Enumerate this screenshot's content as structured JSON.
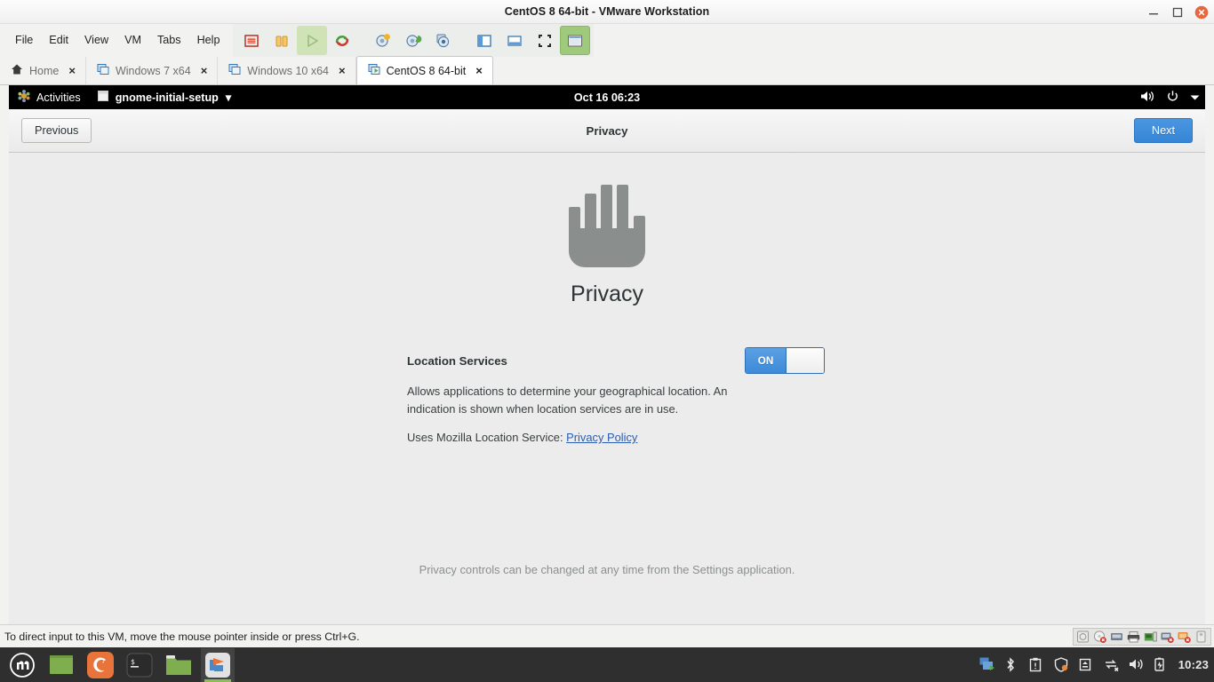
{
  "window": {
    "title": "CentOS 8 64-bit - VMware Workstation",
    "controls": [
      {
        "name": "minimize",
        "label": "–"
      },
      {
        "name": "maximize",
        "label": "□"
      },
      {
        "name": "close",
        "label": "×"
      }
    ]
  },
  "menubar": {
    "items": [
      {
        "label": "File"
      },
      {
        "label": "Edit"
      },
      {
        "label": "View"
      },
      {
        "label": "VM"
      },
      {
        "label": "Tabs"
      },
      {
        "label": "Help"
      }
    ]
  },
  "toolbar": {
    "buttons": [
      {
        "name": "power-off-guest-icon",
        "title": "Power off"
      },
      {
        "name": "suspend-guest-icon",
        "title": "Suspend"
      },
      {
        "name": "play-power-on-icon",
        "title": "Power on",
        "state": "disabled"
      },
      {
        "name": "reset-guest-icon",
        "title": "Reset"
      },
      {
        "name": "snapshot-take-icon",
        "title": "Take snapshot"
      },
      {
        "name": "snapshot-revert-icon",
        "title": "Revert snapshot"
      },
      {
        "name": "snapshot-manager-icon",
        "title": "Manage snapshots"
      },
      {
        "name": "show-library-icon",
        "title": "Show or hide the library"
      },
      {
        "name": "show-thumbnail-bar-icon",
        "title": "Show or hide thumbnail bar"
      },
      {
        "name": "fullscreen-icon",
        "title": "Enter full screen mode"
      },
      {
        "name": "unity-mode-icon",
        "title": "Unity mode",
        "state": "active"
      }
    ]
  },
  "tabs": [
    {
      "label": "Home",
      "icon": "home-icon",
      "active": false,
      "close": "×"
    },
    {
      "label": "Windows 7 x64",
      "icon": "vm-icon",
      "active": false,
      "close": "×"
    },
    {
      "label": "Windows 10 x64",
      "icon": "vm-icon",
      "active": false,
      "close": "×"
    },
    {
      "label": "CentOS 8 64-bit",
      "icon": "vm-running-icon",
      "active": true,
      "close": "×"
    }
  ],
  "guest": {
    "topbar": {
      "activities": "Activities",
      "app_menu": "gnome-initial-setup",
      "app_menu_arrow": "▾",
      "clock": "Oct 16  06:23",
      "indicators": [
        {
          "name": "volume-icon"
        },
        {
          "name": "power-icon"
        },
        {
          "name": "chevron-down-icon"
        }
      ]
    },
    "setup": {
      "header_title": "Privacy",
      "previous_label": "Previous",
      "next_label": "Next",
      "hero_icon": "raised-hand-icon",
      "page_heading": "Privacy",
      "location_services": {
        "label": "Location Services",
        "toggle_state": "ON",
        "description": "Allows applications to determine your geographical location. An indication is shown when location services are in use.",
        "mls_prefix": "Uses Mozilla Location Service:",
        "mls_link": "Privacy Policy"
      },
      "footer_note": "Privacy controls can be changed at any time from the Settings application."
    }
  },
  "statusbar": {
    "message": "To direct input to this VM, move the mouse pointer inside or press Ctrl+G.",
    "devices": [
      {
        "name": "hard-disk-icon"
      },
      {
        "name": "cd-dvd-disconnected-icon"
      },
      {
        "name": "network-adapter-icon"
      },
      {
        "name": "printer-icon"
      },
      {
        "name": "usb-controller-icon"
      },
      {
        "name": "sound-card-disconnected-icon"
      },
      {
        "name": "display-disconnected-icon"
      },
      {
        "name": "usb-device-icon"
      }
    ]
  },
  "taskbar": {
    "apps": [
      {
        "name": "mint-menu-icon"
      },
      {
        "name": "show-desktop-icon"
      },
      {
        "name": "firefox-icon"
      },
      {
        "name": "terminal-icon"
      },
      {
        "name": "file-manager-icon"
      },
      {
        "name": "vmware-workstation-icon",
        "running": true
      }
    ],
    "tray": [
      {
        "name": "vmware-tray-icon"
      },
      {
        "name": "bluetooth-icon"
      },
      {
        "name": "clipboard-icon"
      },
      {
        "name": "update-shield-icon"
      },
      {
        "name": "removable-media-icon"
      },
      {
        "name": "network-disconnected-icon"
      },
      {
        "name": "volume-icon"
      },
      {
        "name": "battery-charging-icon"
      }
    ],
    "clock": "10:23"
  },
  "colors": {
    "accent_blue": "#3685d6",
    "gnome_bg": "#ececec",
    "topbar_black": "#000000",
    "taskbar_dark": "#2f2f2f",
    "link_blue": "#2a5db0",
    "hand_gray": "#8a8e8d"
  }
}
